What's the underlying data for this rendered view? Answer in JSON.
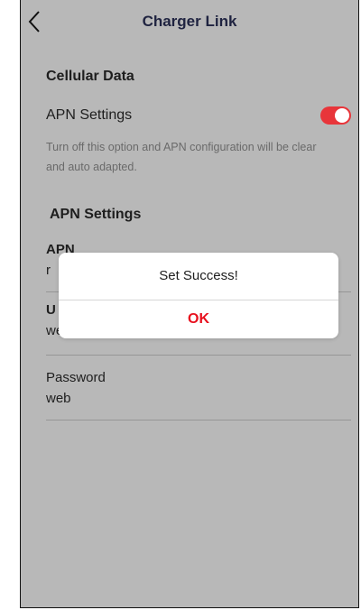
{
  "header": {
    "title": "Charger Link",
    "back_icon": "chevron-left-icon"
  },
  "cellular": {
    "section_title": "Cellular Data",
    "apn_toggle_label": "APN Settings",
    "apn_toggle_on": true,
    "description": "Turn off this option and APN configuration will be clear and auto adapted."
  },
  "apn": {
    "heading": "APN Settings",
    "fields": [
      {
        "label": "APN",
        "value": "r"
      },
      {
        "label": "U",
        "value": "web"
      },
      {
        "label": "Password",
        "value": "web"
      }
    ]
  },
  "dialog": {
    "message": "Set Success!",
    "ok_label": "OK"
  },
  "colors": {
    "accent": "#e8353a",
    "background": "#b8b8b8",
    "title": "#1f2340",
    "ok": "#e8101e"
  }
}
